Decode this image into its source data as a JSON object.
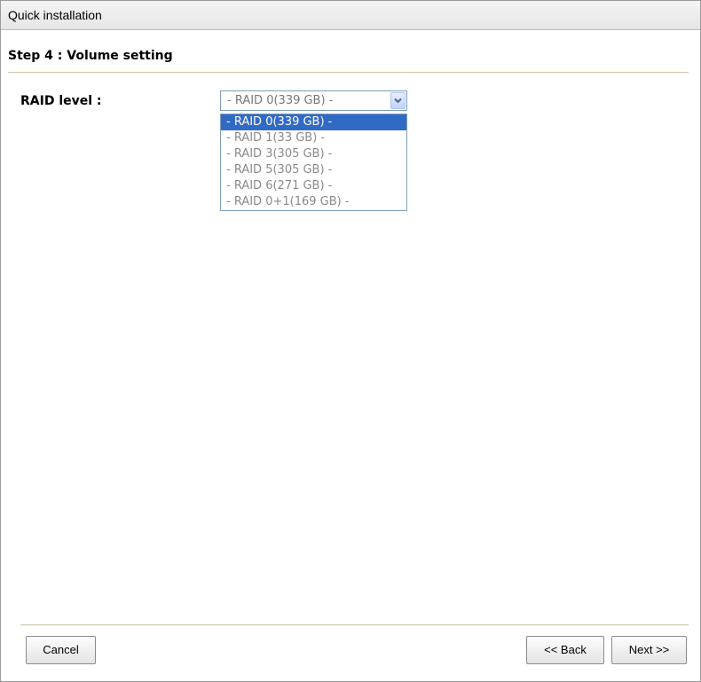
{
  "window": {
    "title": "Quick installation"
  },
  "step": {
    "title": "Step 4 : Volume setting"
  },
  "form": {
    "raid_label": "RAID level :",
    "raid_select": {
      "value": "- RAID 0(339 GB) -",
      "options": [
        "- RAID 0(339 GB) -",
        "- RAID 1(33 GB) -",
        "- RAID 3(305 GB) -",
        "- RAID 5(305 GB) -",
        "- RAID 6(271 GB) -",
        "- RAID 0+1(169 GB) -"
      ],
      "highlighted_index": 0
    }
  },
  "buttons": {
    "cancel": "Cancel",
    "back": "<< Back",
    "next": "Next >>"
  },
  "icons": {
    "dropdown_arrow": "chevron-down-icon"
  },
  "colors": {
    "highlight": "#316ac5",
    "option_text": "#8a8a8a",
    "select_border": "#7f9db9"
  }
}
